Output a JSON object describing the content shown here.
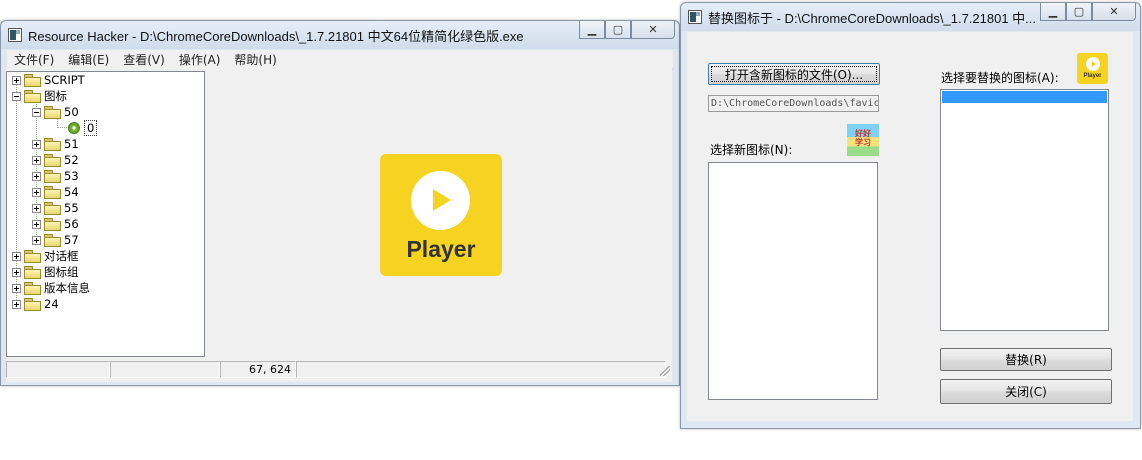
{
  "main_window": {
    "title": "Resource Hacker  -  D:\\ChromeCoreDownloads\\_1.7.21801 中文64位精简化绿色版.exe",
    "menu": [
      "文件(F)",
      "编辑(E)",
      "查看(V)",
      "操作(A)",
      "帮助(H)"
    ],
    "tree": [
      {
        "label": "SCRIPT",
        "depth": 0,
        "expander": "plus"
      },
      {
        "label": "图标",
        "depth": 0,
        "expander": "minus"
      },
      {
        "label": "50",
        "depth": 1,
        "expander": "minus"
      },
      {
        "label": "0",
        "depth": 2,
        "expander": "none",
        "selected": true
      },
      {
        "label": "51",
        "depth": 1,
        "expander": "plus"
      },
      {
        "label": "52",
        "depth": 1,
        "expander": "plus"
      },
      {
        "label": "53",
        "depth": 1,
        "expander": "plus"
      },
      {
        "label": "54",
        "depth": 1,
        "expander": "plus"
      },
      {
        "label": "55",
        "depth": 1,
        "expander": "plus"
      },
      {
        "label": "56",
        "depth": 1,
        "expander": "plus"
      },
      {
        "label": "57",
        "depth": 1,
        "expander": "plus"
      },
      {
        "label": "对话框",
        "depth": 0,
        "expander": "plus"
      },
      {
        "label": "图标组",
        "depth": 0,
        "expander": "plus"
      },
      {
        "label": "版本信息",
        "depth": 0,
        "expander": "plus"
      },
      {
        "label": "24",
        "depth": 0,
        "expander": "plus"
      }
    ],
    "preview_label": "Player",
    "status": [
      "",
      "",
      "67, 624",
      ""
    ]
  },
  "dialog": {
    "title": "替换图标于 - D:\\ChromeCoreDownloads\\_1.7.21801 中...",
    "open_button": "打开含新图标的文件(O)...",
    "file_path": "D:\\ChromeCoreDownloads\\favic",
    "new_icon_label": "选择新图标(N):",
    "replace_icon_label": "选择要替换的图标(A):",
    "replace_button": "替换(R)",
    "close_button": "关闭(C)",
    "fav_icon_text": "好好\n学习",
    "mini_icon_label": "Player"
  },
  "colors": {
    "accent": "#f7d321",
    "selection": "#3399ff"
  }
}
